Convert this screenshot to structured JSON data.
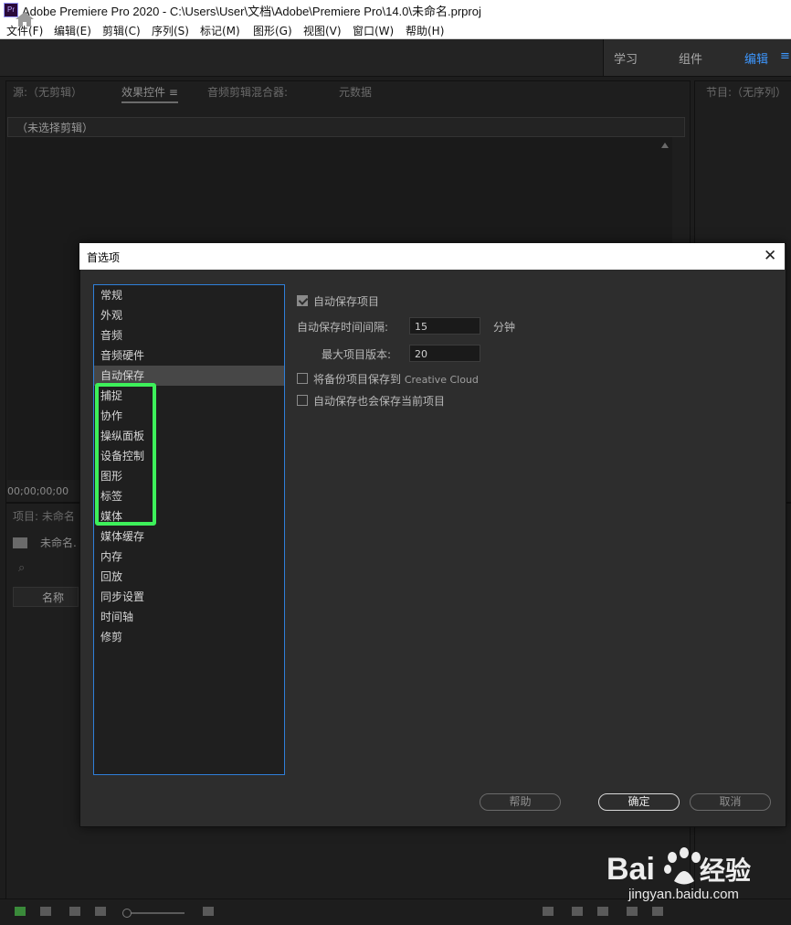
{
  "window": {
    "app_icon_text": "Pr",
    "title": "Adobe Premiere Pro 2020 - C:\\Users\\User\\文档\\Adobe\\Premiere Pro\\14.0\\未命名.prproj"
  },
  "menubar": {
    "items": [
      "文件(F)",
      "编辑(E)",
      "剪辑(C)",
      "序列(S)",
      "标记(M)",
      "图形(G)",
      "视图(V)",
      "窗口(W)",
      "帮助(H)"
    ]
  },
  "workspaces": {
    "tabs": [
      "学习",
      "组件",
      "编辑"
    ],
    "active": "编辑"
  },
  "source_panel": {
    "tabs": [
      "源:（无剪辑）",
      "效果控件",
      "音频剪辑混合器:",
      "元数据"
    ],
    "tab_menu_icon": "≡",
    "clip_header": "（未选择剪辑）",
    "timecode": "00;00;00;00"
  },
  "program_panel": {
    "tab": "节目:（无序列）"
  },
  "project_panel": {
    "tab": "项目: 未命名",
    "project_name": "未命名.",
    "column_name": "名称"
  },
  "dialog": {
    "title": "首选项",
    "close_glyph": "✕",
    "categories": [
      "常规",
      "外观",
      "音频",
      "音频硬件",
      "自动保存",
      "捕捉",
      "协作",
      "操纵面板",
      "设备控制",
      "图形",
      "标签",
      "媒体",
      "媒体缓存",
      "内存",
      "回放",
      "同步设置",
      "时间轴",
      "修剪"
    ],
    "selected_category": "自动保存",
    "options": {
      "autosave_projects": {
        "label": "自动保存项目",
        "checked": true
      },
      "autosave_interval": {
        "label": "自动保存时间间隔:",
        "value": "15",
        "unit": "分钟"
      },
      "max_versions": {
        "label": "最大项目版本:",
        "value": "20"
      },
      "backup_to_cloud": {
        "label": "将备份项目保存到",
        "label_suffix": "Creative Cloud",
        "checked": false
      },
      "autosave_current": {
        "label": "自动保存也会保存当前项目",
        "checked": false
      }
    },
    "buttons": {
      "help": "帮助",
      "ok": "确定",
      "cancel": "取消"
    }
  },
  "watermark": {
    "brand": "Bai 经验",
    "url": "jingyan.baidu.com"
  },
  "colors": {
    "accent_blue": "#3d97ff",
    "list_border": "#2f7fd9",
    "highlight_green": "#3df05a",
    "dialog_bg": "#2d2d2d"
  }
}
